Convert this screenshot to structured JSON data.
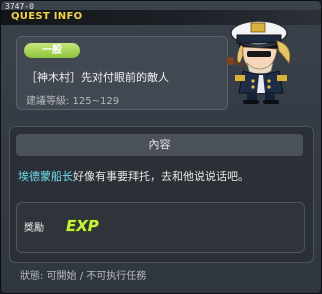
{
  "quest": {
    "id": "3747-0",
    "window_title": "QUEST INFO",
    "category": "一般",
    "name": "［神木村］先对付眼前的敵人",
    "level": "建議等級: 125~129"
  },
  "content": {
    "header": "內容",
    "npc": "埃德蒙船长",
    "text": "好像有事要拜托，去和他说说话吧。"
  },
  "reward": {
    "label": "獎勵",
    "exp": "EXP"
  },
  "status": "狀態: 可開始 / 不可执行任務",
  "colors": {
    "accent": "#f3d24a",
    "npc": "#6ee0f0",
    "pill": "#a4d456"
  },
  "icons": {
    "avatar": "captain-npc",
    "reward": "exp-icon"
  }
}
